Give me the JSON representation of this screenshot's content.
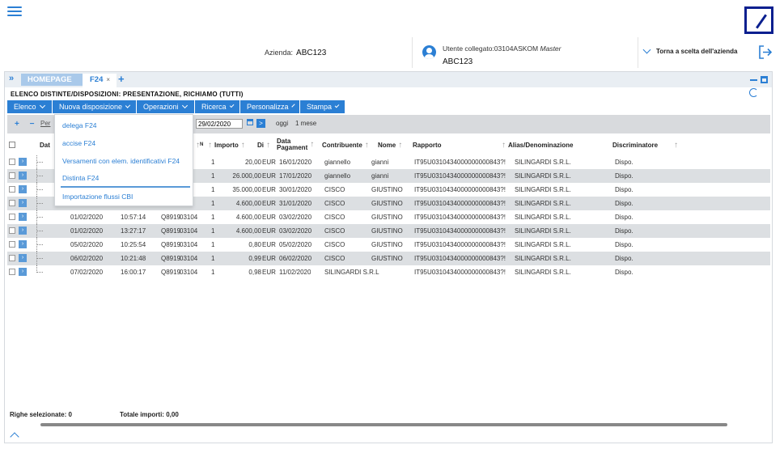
{
  "header": {
    "company_label": "Azienda:",
    "company_value": "ABC123",
    "user_label": "Utente collegato:03104ASKOM",
    "user_role": "Master",
    "user_company": "ABC123",
    "back_link": "Torna a scelta dell'azienda"
  },
  "tabs": {
    "home": "HOMEPAGE",
    "active": "F24",
    "close": "×",
    "add": "+"
  },
  "page_title": "ELENCO DISTINTE/DISPOSIZIONI: PRESENTAZIONE, RICHIAMO (TUTTI)",
  "menu": [
    "Elenco",
    "Nuova disposizione",
    "Operazioni",
    "Ricerca",
    "Personalizza",
    "Stampa"
  ],
  "filter": {
    "per_label": "Per",
    "date_to": "29/02/2020",
    "go": ">",
    "today": "oggi",
    "one_month": "1 mese",
    "plus_minus": "+ −"
  },
  "dropdown": [
    "delega F24",
    "accise F24",
    "Versamenti con elem. identificativi F24",
    "Distinta F24",
    "Importazione flussi CBI"
  ],
  "columns": {
    "dat": "Dat",
    "n": "N",
    "importo": "Importo",
    "di": "Di",
    "data_pag_1": "Data",
    "data_pag_2": "Pagament",
    "contribuente": "Contribuente",
    "nome": "Nome",
    "rapporto": "Rapporto",
    "alias": "Alias/Denominazione",
    "discriminatore": "Discriminatore"
  },
  "rows": [
    {
      "data": "",
      "ora": "",
      "cod": "",
      "num": "",
      "n": "1",
      "importo": "20,00",
      "div": "EUR",
      "data_pag": "16/01/2020",
      "contribuente": "giannello",
      "nome": "gianni",
      "rapporto": "IT95U0310434000000000843?!",
      "alias": "SILINGARDI S.R.L.",
      "discr": "Dispo."
    },
    {
      "data": "",
      "ora": "",
      "cod": "",
      "num": "",
      "n": "1",
      "importo": "26.000,00",
      "div": "EUR",
      "data_pag": "17/01/2020",
      "contribuente": "giannello",
      "nome": "gianni",
      "rapporto": "IT95U0310434000000000843?!",
      "alias": "SILINGARDI S.R.L.",
      "discr": "Dispo."
    },
    {
      "data": "",
      "ora": "",
      "cod": "",
      "num": "",
      "n": "1",
      "importo": "35.000,00",
      "div": "EUR",
      "data_pag": "30/01/2020",
      "contribuente": "CISCO",
      "nome": "GIUSTINO",
      "rapporto": "IT95U0310434000000000843?!",
      "alias": "SILINGARDI S.R.L.",
      "discr": "Dispo."
    },
    {
      "data": "",
      "ora": "",
      "cod": "",
      "num": "",
      "n": "1",
      "importo": "4.600,00",
      "div": "EUR",
      "data_pag": "31/01/2020",
      "contribuente": "CISCO",
      "nome": "GIUSTINO",
      "rapporto": "IT95U0310434000000000843?!",
      "alias": "SILINGARDI S.R.L.",
      "discr": "Dispo."
    },
    {
      "data": "01/02/2020",
      "ora": "10:57:14",
      "cod": "Q8919",
      "num": "03104",
      "n": "1",
      "importo": "4.600,00",
      "div": "EUR",
      "data_pag": "03/02/2020",
      "contribuente": "CISCO",
      "nome": "GIUSTINO",
      "rapporto": "IT95U0310434000000000843?!",
      "alias": "SILINGARDI S.R.L.",
      "discr": "Dispo."
    },
    {
      "data": "01/02/2020",
      "ora": "13:27:17",
      "cod": "Q8919",
      "num": "03104",
      "n": "1",
      "importo": "4.600,00",
      "div": "EUR",
      "data_pag": "03/02/2020",
      "contribuente": "CISCO",
      "nome": "GIUSTINO",
      "rapporto": "IT95U0310434000000000843?!",
      "alias": "SILINGARDI S.R.L.",
      "discr": "Dispo."
    },
    {
      "data": "05/02/2020",
      "ora": "10:25:54",
      "cod": "Q8919",
      "num": "03104",
      "n": "1",
      "importo": "0,80",
      "div": "EUR",
      "data_pag": "05/02/2020",
      "contribuente": "CISCO",
      "nome": "GIUSTINO",
      "rapporto": "IT95U0310434000000000843?!",
      "alias": "SILINGARDI S.R.L.",
      "discr": "Dispo."
    },
    {
      "data": "06/02/2020",
      "ora": "10:21:48",
      "cod": "Q8919",
      "num": "03104",
      "n": "1",
      "importo": "0,99",
      "div": "EUR",
      "data_pag": "06/02/2020",
      "contribuente": "CISCO",
      "nome": "GIUSTINO",
      "rapporto": "IT95U0310434000000000843?!",
      "alias": "SILINGARDI S.R.L.",
      "discr": "Dispo."
    },
    {
      "data": "07/02/2020",
      "ora": "16:00:17",
      "cod": "Q8919",
      "num": "03104",
      "n": "1",
      "importo": "0,98",
      "div": "EUR",
      "data_pag": "11/02/2020",
      "contribuente": "SILINGARDI S.R.L",
      "nome": "",
      "rapporto": "IT95U0310434000000000843?!",
      "alias": "SILINGARDI S.R.L.",
      "discr": "Dispo."
    }
  ],
  "footer": {
    "selected_label": "Righe selezionate:",
    "selected_value": "0",
    "total_label": "Totale importi:",
    "total_value": "0,00"
  },
  "colors": {
    "accent": "#2b7fd4",
    "row_alt": "#dcdfe2",
    "logo": "#0a1f8f"
  }
}
